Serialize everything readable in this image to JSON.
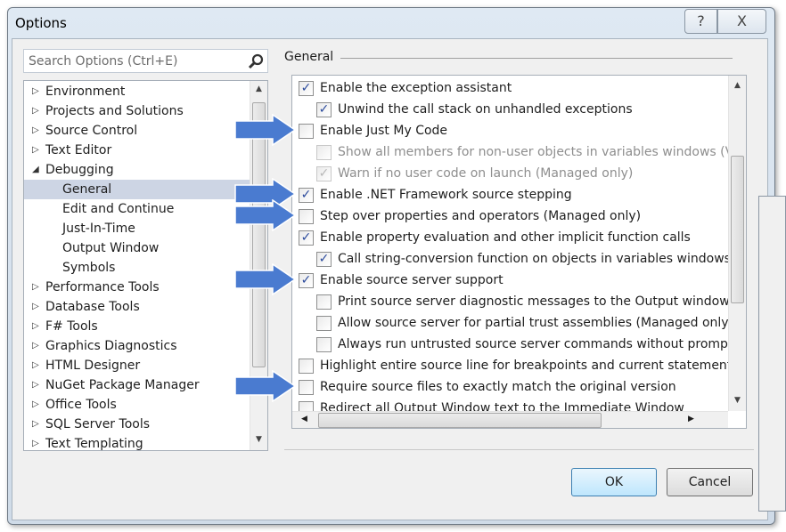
{
  "window": {
    "title": "Options",
    "help_label": "?",
    "close_label": "X"
  },
  "search": {
    "placeholder": "Search Options (Ctrl+E)"
  },
  "tree": {
    "items": [
      {
        "label": "Environment",
        "level": 0,
        "expander": "collapsed"
      },
      {
        "label": "Projects and Solutions",
        "level": 0,
        "expander": "collapsed"
      },
      {
        "label": "Source Control",
        "level": 0,
        "expander": "collapsed"
      },
      {
        "label": "Text Editor",
        "level": 0,
        "expander": "collapsed"
      },
      {
        "label": "Debugging",
        "level": 0,
        "expander": "expanded"
      },
      {
        "label": "General",
        "level": 1,
        "selected": true
      },
      {
        "label": "Edit and Continue",
        "level": 1
      },
      {
        "label": "Just-In-Time",
        "level": 1
      },
      {
        "label": "Output Window",
        "level": 1
      },
      {
        "label": "Symbols",
        "level": 1
      },
      {
        "label": "Performance Tools",
        "level": 0,
        "expander": "collapsed"
      },
      {
        "label": "Database Tools",
        "level": 0,
        "expander": "collapsed"
      },
      {
        "label": "F# Tools",
        "level": 0,
        "expander": "collapsed"
      },
      {
        "label": "Graphics Diagnostics",
        "level": 0,
        "expander": "collapsed"
      },
      {
        "label": "HTML Designer",
        "level": 0,
        "expander": "collapsed"
      },
      {
        "label": "NuGet Package Manager",
        "level": 0,
        "expander": "collapsed"
      },
      {
        "label": "Office Tools",
        "level": 0,
        "expander": "collapsed"
      },
      {
        "label": "SQL Server Tools",
        "level": 0,
        "expander": "collapsed"
      },
      {
        "label": "Text Templating",
        "level": 0,
        "expander": "collapsed"
      }
    ]
  },
  "section": {
    "title": "General"
  },
  "options": [
    {
      "label": "Enable the exception assistant",
      "checked": true,
      "level": 0
    },
    {
      "label": "Unwind the call stack on unhandled exceptions",
      "checked": true,
      "level": 1
    },
    {
      "label": "Enable Just My Code",
      "checked": false,
      "level": 0,
      "highlighted": true
    },
    {
      "label": "Show all members for non-user objects in variables windows (Visu",
      "checked": false,
      "level": 1,
      "disabled": true
    },
    {
      "label": "Warn if no user code on launch (Managed only)",
      "checked": true,
      "level": 1,
      "disabled": true
    },
    {
      "label": "Enable .NET Framework source stepping",
      "checked": true,
      "level": 0,
      "highlighted": true
    },
    {
      "label": "Step over properties and operators (Managed only)",
      "checked": false,
      "level": 0,
      "highlighted": true
    },
    {
      "label": "Enable property evaluation and other implicit function calls",
      "checked": true,
      "level": 0
    },
    {
      "label": "Call string-conversion function on objects in variables windows",
      "checked": true,
      "level": 1
    },
    {
      "label": "Enable source server support",
      "checked": true,
      "level": 0,
      "highlighted": true
    },
    {
      "label": "Print source server diagnostic messages to the Output window",
      "checked": false,
      "level": 1
    },
    {
      "label": "Allow source server for partial trust assemblies (Managed only)",
      "checked": false,
      "level": 1
    },
    {
      "label": "Always run untrusted source server commands without prompting",
      "checked": false,
      "level": 1
    },
    {
      "label": "Highlight entire source line for breakpoints and current statement (C-",
      "checked": false,
      "level": 0
    },
    {
      "label": "Require source files to exactly match the original version",
      "checked": false,
      "level": 0,
      "highlighted": true
    },
    {
      "label": "Redirect all Output Window text to the Immediate Window",
      "checked": false,
      "level": 0
    }
  ],
  "buttons": {
    "ok": "OK",
    "cancel": "Cancel"
  },
  "colors": {
    "arrow": "#4a7bd0",
    "selection": "#cdd5e4",
    "check": "#2b4a9c"
  }
}
